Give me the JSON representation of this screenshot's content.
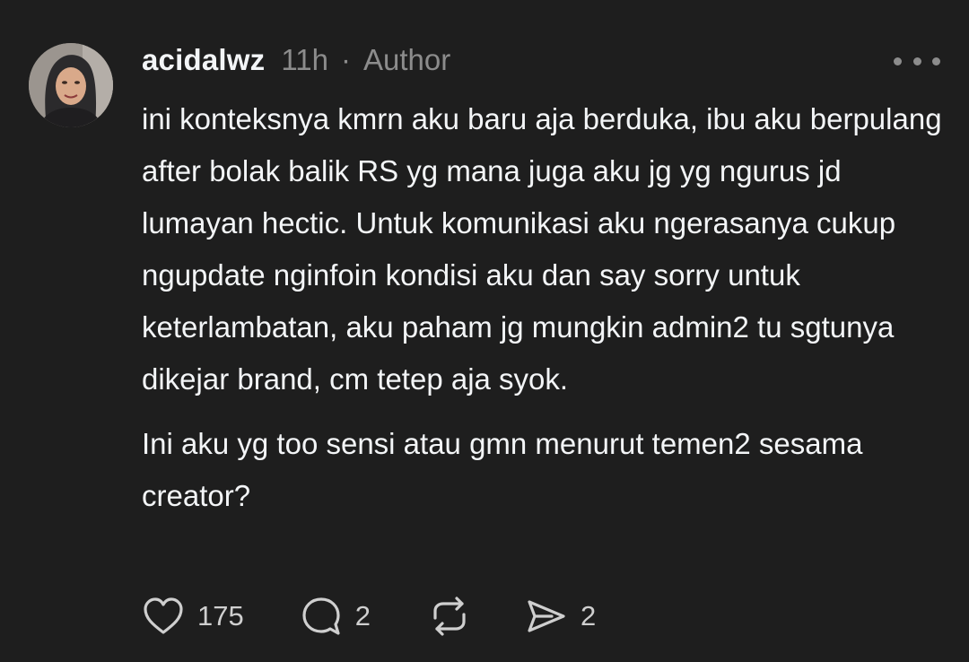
{
  "post": {
    "username": "acidalwz",
    "time": "11h",
    "separator": "·",
    "role": "Author",
    "paragraphs": [
      "ini konteksnya kmrn aku baru aja berduka, ibu aku berpulang after bolak balik RS yg mana juga aku jg yg ngurus jd lumayan hectic. Untuk komunikasi aku ngerasanya cukup ngupdate nginfoin kondisi aku dan say sorry untuk keterlambatan, aku paham jg mungkin admin2 tu sgtunya dikejar brand, cm tetep aja syok.",
      "Ini aku yg too sensi atau gmn menurut temen2 sesama creator?"
    ],
    "actions": {
      "likes": "175",
      "replies": "2",
      "shares": "2"
    }
  },
  "colors": {
    "background": "#1e1e1e",
    "text": "#f3f5f7",
    "muted": "#8c8c8c"
  },
  "icons": {
    "more": "more-horizontal-icon",
    "like": "heart-icon",
    "reply": "speech-bubble-icon",
    "repost": "repost-arrows-icon",
    "share": "paper-plane-icon"
  }
}
